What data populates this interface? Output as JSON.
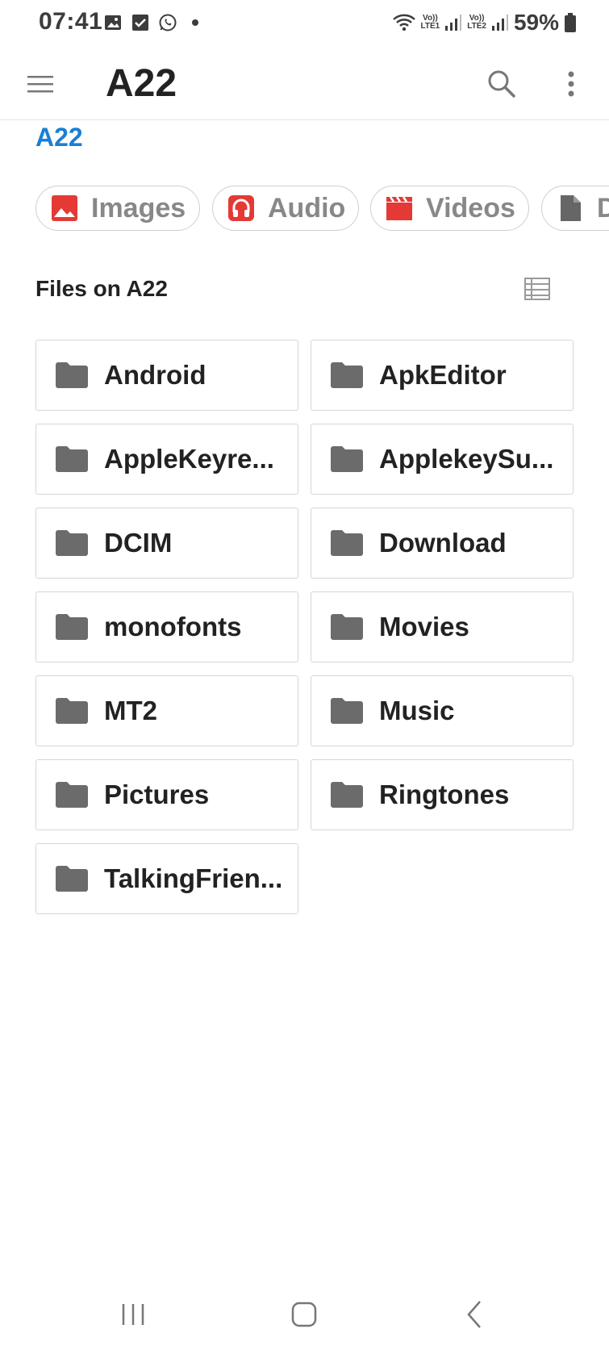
{
  "status_bar": {
    "time": "07:41",
    "battery": "59%",
    "sim1": "LTE1",
    "sim2": "LTE2",
    "volte": "Vo))",
    "icons": [
      "gallery-icon",
      "check-icon",
      "whatsapp-icon",
      "dot-icon",
      "wifi-icon",
      "signal-icon",
      "signal-icon",
      "battery-icon"
    ]
  },
  "app_bar": {
    "title": "A22",
    "icons": [
      "menu-icon",
      "search-icon",
      "more-vert-icon"
    ]
  },
  "breadcrumb": "A22",
  "categories": [
    {
      "label": "Images",
      "icon": "image-icon",
      "color": "#e53935"
    },
    {
      "label": "Audio",
      "icon": "headphones-icon",
      "color": "#e53935"
    },
    {
      "label": "Videos",
      "icon": "movie-icon",
      "color": "#e53935"
    },
    {
      "label": "D",
      "icon": "document-icon",
      "color": "#666666"
    }
  ],
  "section": {
    "title": "Files on A22",
    "view_icon": "list-view-icon"
  },
  "folders": [
    {
      "name": "Android"
    },
    {
      "name": "ApkEditor"
    },
    {
      "name": "AppleKeyre..."
    },
    {
      "name": "ApplekeySu..."
    },
    {
      "name": "DCIM"
    },
    {
      "name": "Download"
    },
    {
      "name": "monofonts"
    },
    {
      "name": "Movies"
    },
    {
      "name": "MT2"
    },
    {
      "name": "Music"
    },
    {
      "name": "Pictures"
    },
    {
      "name": "Ringtones"
    },
    {
      "name": "TalkingFrien..."
    }
  ],
  "nav_bar": {
    "icons": [
      "recents-icon",
      "home-icon",
      "back-icon"
    ]
  },
  "colors": {
    "accent": "#1a7fd6",
    "category_red": "#e53935",
    "folder_gray": "#6b6b6b"
  }
}
